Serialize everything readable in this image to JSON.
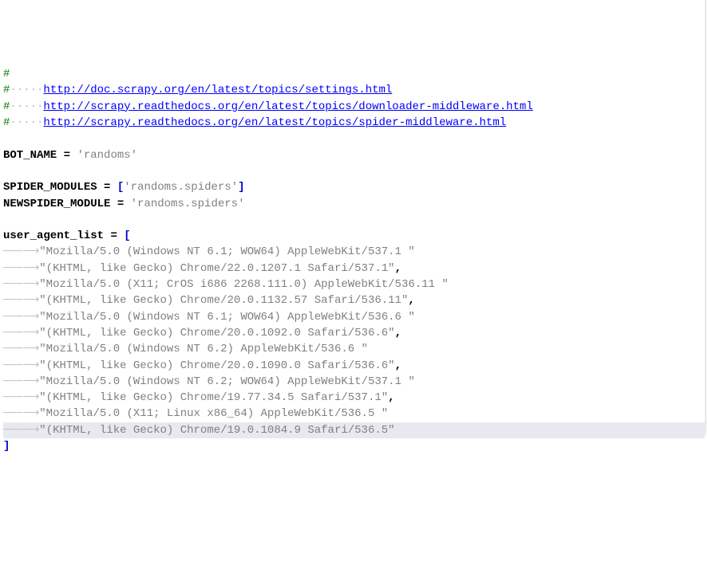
{
  "lines": [
    {
      "seg": [
        {
          "cls": "comment",
          "t": "#"
        }
      ]
    },
    {
      "seg": [
        {
          "cls": "comment",
          "t": "#"
        },
        {
          "cls": "comment-dot",
          "t": "·····"
        },
        {
          "cls": "link",
          "t": "http://doc.scrapy.org/en/latest/topics/settings.html"
        }
      ]
    },
    {
      "seg": [
        {
          "cls": "comment",
          "t": "#"
        },
        {
          "cls": "comment-dot",
          "t": "·····"
        },
        {
          "cls": "link",
          "t": "http://scrapy.readthedocs.org/en/latest/topics/downloader-middleware.html"
        }
      ]
    },
    {
      "seg": [
        {
          "cls": "comment",
          "t": "#"
        },
        {
          "cls": "comment-dot",
          "t": "·····"
        },
        {
          "cls": "link",
          "t": "http://scrapy.readthedocs.org/en/latest/topics/spider-middleware.html"
        }
      ]
    },
    {
      "seg": []
    },
    {
      "seg": [
        {
          "cls": "ident",
          "t": "BOT_NAME"
        },
        {
          "cls": "plain",
          "t": " "
        },
        {
          "cls": "op",
          "t": "="
        },
        {
          "cls": "plain",
          "t": " "
        },
        {
          "cls": "string",
          "t": "'randoms'"
        }
      ]
    },
    {
      "seg": []
    },
    {
      "seg": [
        {
          "cls": "ident",
          "t": "SPIDER_MODULES"
        },
        {
          "cls": "plain",
          "t": " "
        },
        {
          "cls": "op",
          "t": "="
        },
        {
          "cls": "plain",
          "t": " "
        },
        {
          "cls": "bracket",
          "t": "["
        },
        {
          "cls": "string",
          "t": "'randoms.spiders'"
        },
        {
          "cls": "bracket",
          "t": "]"
        }
      ]
    },
    {
      "seg": [
        {
          "cls": "ident",
          "t": "NEWSPIDER_MODULE"
        },
        {
          "cls": "plain",
          "t": " "
        },
        {
          "cls": "op",
          "t": "="
        },
        {
          "cls": "plain",
          "t": " "
        },
        {
          "cls": "string",
          "t": "'randoms.spiders'"
        }
      ]
    },
    {
      "seg": []
    },
    {
      "seg": [
        {
          "cls": "ident",
          "t": "user_agent_list"
        },
        {
          "cls": "plain",
          "t": " "
        },
        {
          "cls": "op",
          "t": "="
        },
        {
          "cls": "plain",
          "t": " "
        },
        {
          "cls": "bracket",
          "t": "["
        }
      ]
    },
    {
      "seg": [
        {
          "cls": "tab-arrow",
          "t": "───⟶"
        },
        {
          "cls": "string",
          "t": "\"Mozilla/5.0 (Windows NT 6.1; WOW64) AppleWebKit/537.1 \""
        }
      ]
    },
    {
      "seg": [
        {
          "cls": "tab-arrow",
          "t": "───⟶"
        },
        {
          "cls": "string",
          "t": "\"(KHTML, like Gecko) Chrome/22.0.1207.1 Safari/537.1\""
        },
        {
          "cls": "op",
          "t": ","
        }
      ]
    },
    {
      "seg": [
        {
          "cls": "tab-arrow",
          "t": "───⟶"
        },
        {
          "cls": "string",
          "t": "\"Mozilla/5.0 (X11; CrOS i686 2268.111.0) AppleWebKit/536.11 \""
        }
      ]
    },
    {
      "seg": [
        {
          "cls": "tab-arrow",
          "t": "───⟶"
        },
        {
          "cls": "string",
          "t": "\"(KHTML, like Gecko) Chrome/20.0.1132.57 Safari/536.11\""
        },
        {
          "cls": "op",
          "t": ","
        }
      ]
    },
    {
      "seg": [
        {
          "cls": "tab-arrow",
          "t": "───⟶"
        },
        {
          "cls": "string",
          "t": "\"Mozilla/5.0 (Windows NT 6.1; WOW64) AppleWebKit/536.6 \""
        }
      ]
    },
    {
      "seg": [
        {
          "cls": "tab-arrow",
          "t": "───⟶"
        },
        {
          "cls": "string",
          "t": "\"(KHTML, like Gecko) Chrome/20.0.1092.0 Safari/536.6\""
        },
        {
          "cls": "op",
          "t": ","
        }
      ]
    },
    {
      "seg": [
        {
          "cls": "tab-arrow",
          "t": "───⟶"
        },
        {
          "cls": "string",
          "t": "\"Mozilla/5.0 (Windows NT 6.2) AppleWebKit/536.6 \""
        }
      ]
    },
    {
      "seg": [
        {
          "cls": "tab-arrow",
          "t": "───⟶"
        },
        {
          "cls": "string",
          "t": "\"(KHTML, like Gecko) Chrome/20.0.1090.0 Safari/536.6\""
        },
        {
          "cls": "op",
          "t": ","
        }
      ]
    },
    {
      "seg": [
        {
          "cls": "tab-arrow",
          "t": "───⟶"
        },
        {
          "cls": "string",
          "t": "\"Mozilla/5.0 (Windows NT 6.2; WOW64) AppleWebKit/537.1 \""
        }
      ]
    },
    {
      "seg": [
        {
          "cls": "tab-arrow",
          "t": "───⟶"
        },
        {
          "cls": "string",
          "t": "\"(KHTML, like Gecko) Chrome/19.77.34.5 Safari/537.1\""
        },
        {
          "cls": "op",
          "t": ","
        }
      ]
    },
    {
      "seg": [
        {
          "cls": "tab-arrow",
          "t": "───⟶"
        },
        {
          "cls": "string",
          "t": "\"Mozilla/5.0 (X11; Linux x86_64) AppleWebKit/536.5 \""
        }
      ]
    },
    {
      "highlight": true,
      "seg": [
        {
          "cls": "tab-arrow",
          "t": "───⟶"
        },
        {
          "cls": "string",
          "t": "\"(KHTML, like Gecko) Chrome/19.0.1084.9 Safari/536.5\""
        }
      ]
    },
    {
      "seg": [
        {
          "cls": "bracket",
          "t": "]"
        }
      ]
    },
    {
      "seg": []
    }
  ]
}
